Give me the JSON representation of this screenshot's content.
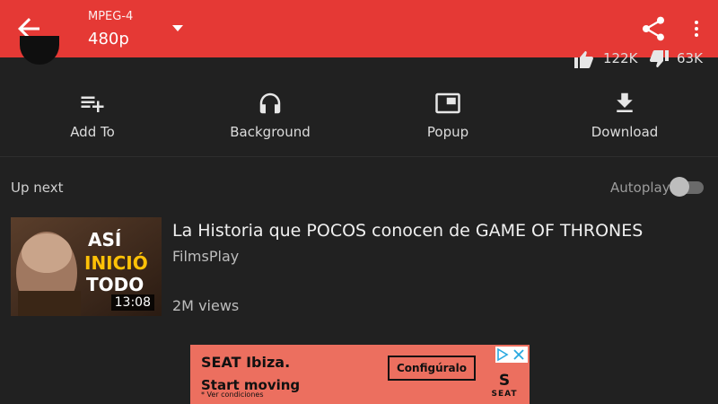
{
  "appbar": {
    "format": "MPEG-4",
    "resolution": "480p",
    "color": "#e53935",
    "icons": [
      "arrow-back-icon",
      "dropdown-triangle-icon",
      "share-icon",
      "more-vert-icon"
    ]
  },
  "stats": {
    "likes": "122K",
    "dislikes": "63K"
  },
  "actions": [
    {
      "label": "Add To",
      "icon": "playlist-add-icon"
    },
    {
      "label": "Background",
      "icon": "headphones-icon"
    },
    {
      "label": "Popup",
      "icon": "popup-icon"
    },
    {
      "label": "Download",
      "icon": "download-icon"
    }
  ],
  "upnext": {
    "label": "Up next",
    "autoplay_label": "Autoplay",
    "autoplay_on": false
  },
  "video": {
    "title": "La Historia que POCOS conocen de GAME OF THRONES",
    "channel": "FilmsPlay",
    "views": "2M views",
    "duration": "13:08",
    "thumb_text": [
      "ASÍ",
      "INICIÓ",
      "TODO"
    ]
  },
  "ad": {
    "brand": "SEAT Ibiza.",
    "slogan": "Start moving",
    "conditions": "* Ver condiciones",
    "cta": "Configúralo",
    "logo_text": "SEAT",
    "color": "#ec6f5f"
  }
}
